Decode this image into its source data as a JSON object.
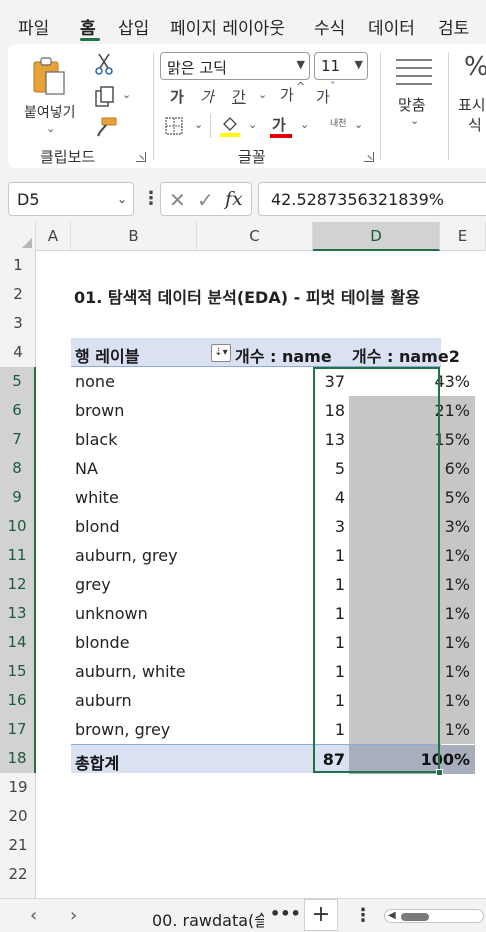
{
  "menu": {
    "items": [
      "파일",
      "홈",
      "삽입",
      "페이지 레이아웃",
      "수식",
      "데이터",
      "검토"
    ],
    "active": "홈"
  },
  "ribbon": {
    "clipboard": {
      "paste_label": "붙여넣기",
      "group_label": "클립보드"
    },
    "font": {
      "font_name": "맑은 고딕",
      "font_size": "11",
      "bold": "가",
      "italic": "가",
      "underline": "간",
      "grow": "가",
      "shrink": "가",
      "font_color": "가",
      "phonetic": "내천",
      "group_label": "글꼴"
    },
    "alignment": {
      "label": "맞춤"
    },
    "number": {
      "percent_symbol": "%",
      "label_line1": "표시",
      "label_line2": "식"
    }
  },
  "formula_bar": {
    "name_box": "D5",
    "fx": "fx",
    "value": "42.5287356321839%"
  },
  "grid": {
    "columns": [
      "A",
      "B",
      "C",
      "D",
      "E"
    ],
    "selected_column": "D",
    "rows": [
      "1",
      "2",
      "3",
      "4",
      "5",
      "6",
      "7",
      "8",
      "9",
      "10",
      "11",
      "12",
      "13",
      "14",
      "15",
      "16",
      "17",
      "18",
      "19",
      "20",
      "21",
      "22"
    ],
    "selected_rows": [
      "5",
      "6",
      "7",
      "8",
      "9",
      "10",
      "11",
      "12",
      "13",
      "14",
      "15",
      "16",
      "17",
      "18"
    ],
    "title": "01. 탐색적 데이터 분석(EDA) - 피벗 테이블 활용",
    "pivot": {
      "header": {
        "row_label": "행 레이블",
        "count_name": "개수 : name",
        "count_name2": "개수 : name2"
      },
      "rows": [
        {
          "label": "none",
          "count": "37",
          "pct": "43%"
        },
        {
          "label": "brown",
          "count": "18",
          "pct": "21%"
        },
        {
          "label": "black",
          "count": "13",
          "pct": "15%"
        },
        {
          "label": "NA",
          "count": "5",
          "pct": "6%"
        },
        {
          "label": "white",
          "count": "4",
          "pct": "5%"
        },
        {
          "label": "blond",
          "count": "3",
          "pct": "3%"
        },
        {
          "label": "auburn, grey",
          "count": "1",
          "pct": "1%"
        },
        {
          "label": "grey",
          "count": "1",
          "pct": "1%"
        },
        {
          "label": "unknown",
          "count": "1",
          "pct": "1%"
        },
        {
          "label": "blonde",
          "count": "1",
          "pct": "1%"
        },
        {
          "label": "auburn, white",
          "count": "1",
          "pct": "1%"
        },
        {
          "label": "auburn",
          "count": "1",
          "pct": "1%"
        },
        {
          "label": "brown, grey",
          "count": "1",
          "pct": "1%"
        }
      ],
      "total": {
        "label": "총합계",
        "count": "87",
        "pct": "100%"
      }
    }
  },
  "sheet_bar": {
    "prev": "‹",
    "next": "›",
    "tab": "00. rawdata(슬",
    "more": "•••",
    "add": "+",
    "menu": "⋮"
  },
  "colors": {
    "accent": "#217346",
    "pivot_header_bg": "#d9e1f2",
    "pivot_total_pct_bg": "#a7aebd",
    "selection_shade": "#c6c6c6"
  }
}
